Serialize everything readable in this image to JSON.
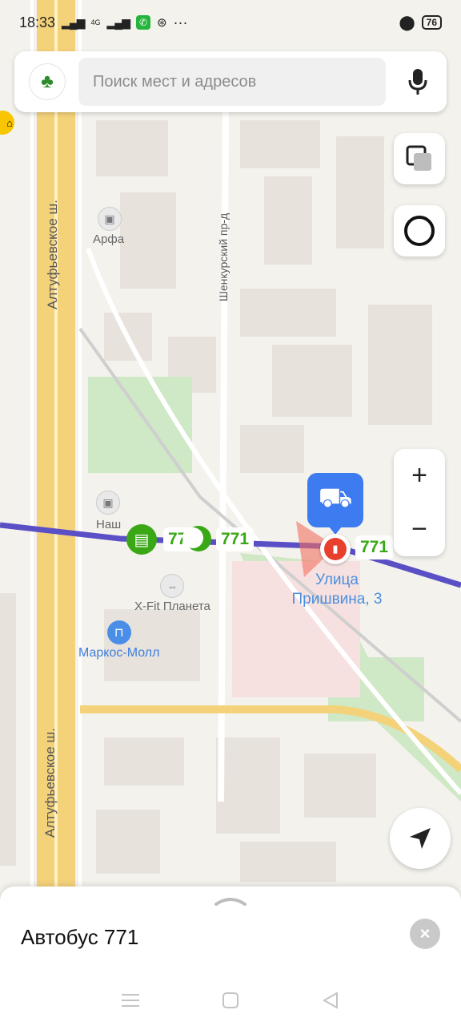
{
  "status_bar": {
    "time": "18:33",
    "network": "4G",
    "battery": "76",
    "more": "···"
  },
  "search": {
    "placeholder": "Поиск мест и адресов"
  },
  "map": {
    "streets": {
      "altufyevskoe_top": "Алтуфьевское ш.",
      "altufyevskoe_bottom": "Алтуфьевское ш.",
      "shenkursky": "Шенкурский пр-д"
    },
    "pois": {
      "arfa": "Арфа",
      "nash": "Наш",
      "xfit": "X-Fit Планета",
      "markos": "Маркос-Молл"
    },
    "route_labels": [
      "771",
      "771",
      "771"
    ],
    "stop_name": "Улица Пришвина, 3"
  },
  "zoom": {
    "plus": "+",
    "minus": "−"
  },
  "panel": {
    "title": "Автобус 771",
    "close": "×"
  },
  "colors": {
    "route": "#5b4fc6",
    "bus_green": "#3aa816",
    "stop_red": "#e8402c",
    "accent_blue": "#3d7bf0",
    "poi_blue": "#4a8ee8",
    "road_yellow": "#f4d27a"
  }
}
